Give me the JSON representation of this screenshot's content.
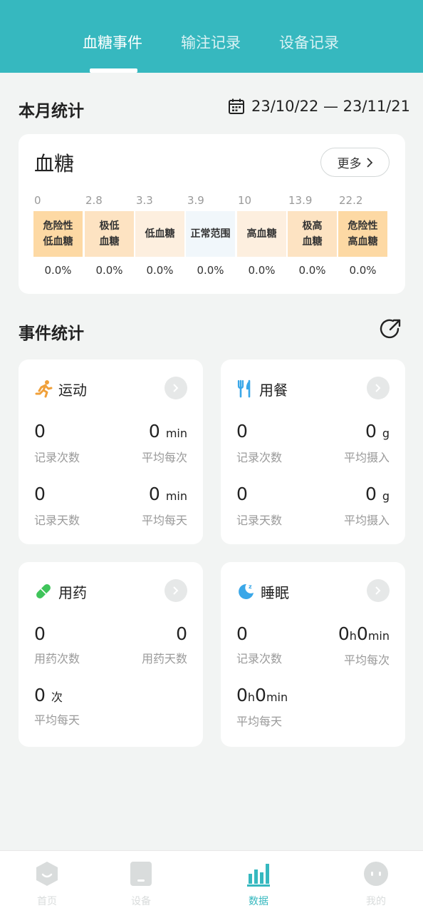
{
  "header": {
    "tabs": [
      {
        "label": "血糖事件",
        "active": true
      },
      {
        "label": "输注记录",
        "active": false
      },
      {
        "label": "设备记录",
        "active": false
      }
    ]
  },
  "monthly": {
    "title": "本月统计",
    "date_range": "23/10/22 — 23/11/21"
  },
  "glucose": {
    "title": "血糖",
    "more_label": "更多",
    "ticks": [
      "0",
      "2.8",
      "3.3",
      "3.9",
      "10",
      "13.9",
      "22.2"
    ],
    "ranges": [
      {
        "line1": "危险性",
        "line2": "低血糖",
        "color": "#fdd9a4",
        "pct": "0.0%"
      },
      {
        "line1": "极低",
        "line2": "血糖",
        "color": "#fde3c2",
        "pct": "0.0%"
      },
      {
        "line1": "低血糖",
        "line2": "",
        "color": "#fdefdf",
        "pct": "0.0%"
      },
      {
        "line1": "正常范围",
        "line2": "",
        "color": "#f1f7fb",
        "pct": "0.0%"
      },
      {
        "line1": "高血糖",
        "line2": "",
        "color": "#fdefdf",
        "pct": "0.0%"
      },
      {
        "line1": "极高",
        "line2": "血糖",
        "color": "#fde3c2",
        "pct": "0.0%"
      },
      {
        "line1": "危险性",
        "line2": "高血糖",
        "color": "#fdd9a4",
        "pct": "0.0%"
      }
    ]
  },
  "events": {
    "title": "事件统计",
    "exercise": {
      "name": "运动",
      "count": "0",
      "count_label": "记录次数",
      "avg_each": "0",
      "avg_each_unit": "min",
      "avg_each_label": "平均每次",
      "days": "0",
      "days_label": "记录天数",
      "avg_day": "0",
      "avg_day_unit": "min",
      "avg_day_label": "平均每天"
    },
    "meal": {
      "name": "用餐",
      "count": "0",
      "count_label": "记录次数",
      "intake1": "0",
      "intake1_unit": "g",
      "intake1_label": "平均摄入",
      "days": "0",
      "days_label": "记录天数",
      "intake2": "0",
      "intake2_unit": "g",
      "intake2_label": "平均摄入"
    },
    "medicine": {
      "name": "用药",
      "count": "0",
      "count_label": "用药次数",
      "days": "0",
      "days_label": "用药天数",
      "avg_day": "0",
      "avg_day_unit": "次",
      "avg_day_label": "平均每天"
    },
    "sleep": {
      "name": "睡眠",
      "count": "0",
      "count_label": "记录次数",
      "avg_each_h": "0",
      "avg_each_m": "0",
      "avg_each_label": "平均每次",
      "avg_day_h": "0",
      "avg_day_m": "0",
      "avg_day_label": "平均每天",
      "h_unit": "h",
      "m_unit": "min"
    }
  },
  "nav": {
    "items": [
      {
        "label": "首页",
        "active": false
      },
      {
        "label": "设备",
        "active": false
      },
      {
        "label": "数据",
        "active": true
      },
      {
        "label": "我的",
        "active": false
      }
    ]
  },
  "colors": {
    "accent": "#36b8bf"
  }
}
